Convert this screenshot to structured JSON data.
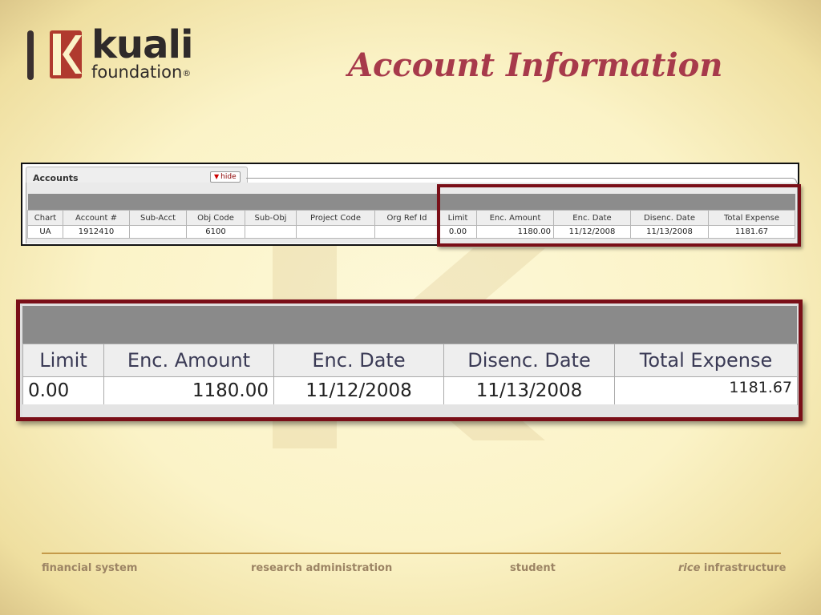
{
  "brand": {
    "logo_word": "kuali",
    "logo_sub": "foundation",
    "registered_mark": "®",
    "accent_color": "#a73a4b",
    "highlight_color": "#7a0f18"
  },
  "slide": {
    "title": "Account Information"
  },
  "accounts_panel": {
    "section_label": "Accounts",
    "hide_button_label": "hide",
    "columns": [
      "Chart",
      "Account #",
      "Sub-Acct",
      "Obj Code",
      "Sub-Obj",
      "Project Code",
      "Org Ref Id",
      "Limit",
      "Enc. Amount",
      "Enc. Date",
      "Disenc. Date",
      "Total Expense"
    ],
    "row": {
      "chart": "UA",
      "account": "1912410",
      "sub_acct": "",
      "obj_code": "6100",
      "sub_obj": "",
      "project_code": "",
      "org_ref_id": "",
      "limit": "0.00",
      "enc_amount": "1180.00",
      "enc_date": "11/12/2008",
      "disenc_date": "11/13/2008",
      "total_expense": "1181.67"
    }
  },
  "zoom_panel": {
    "columns": [
      "Limit",
      "Enc. Amount",
      "Enc. Date",
      "Disenc. Date",
      "Total Expense"
    ],
    "row": {
      "limit": "0.00",
      "enc_amount": "1180.00",
      "enc_date": "11/12/2008",
      "disenc_date": "11/13/2008",
      "total_expense": "1181.67"
    }
  },
  "footer": {
    "items": [
      "financial system",
      "research administration",
      "student"
    ],
    "last_item_italic": "rice",
    "last_item_rest": " infrastructure"
  }
}
